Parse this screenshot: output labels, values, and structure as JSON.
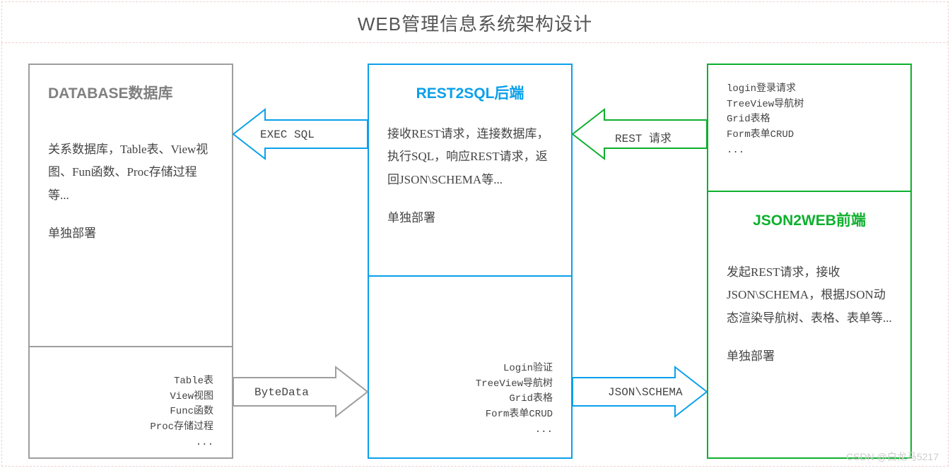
{
  "title": "WEB管理信息系统架构设计",
  "db": {
    "heading": "DATABASE数据库",
    "body": "关系数据库，Table表、View视图、Fun函数、Proc存储过程等...",
    "deploy": "单独部署",
    "sub": [
      "Table表",
      "View视图",
      "Func函数",
      "Proc存储过程",
      "..."
    ]
  },
  "mid": {
    "heading": "REST2SQL后端",
    "body": "接收REST请求，连接数据库，执行SQL，响应REST请求，返回JSON\\SCHEMA等...",
    "deploy": "单独部署",
    "sub": [
      "Login验证",
      "TreeView导航树",
      "Grid表格",
      "Form表单CRUD",
      "..."
    ]
  },
  "fe": {
    "top": [
      "login登录请求",
      "TreeView导航树",
      "Grid表格",
      "Form表单CRUD",
      "..."
    ],
    "heading": "JSON2WEB前端",
    "body": "发起REST请求，接收JSON\\SCHEMA，根据JSON动态渲染导航树、表格、表单等...",
    "deploy": "单独部署"
  },
  "arrows": {
    "exec_sql": "EXEC SQL",
    "rest_req": "REST 请求",
    "bytedata": "ByteData",
    "json_schema": "JSON\\SCHEMA"
  },
  "colors": {
    "gray": "#9e9e9e",
    "blue": "#0aa0ea",
    "green": "#0db02d"
  },
  "watermark": "CSDN @白龙马5217"
}
